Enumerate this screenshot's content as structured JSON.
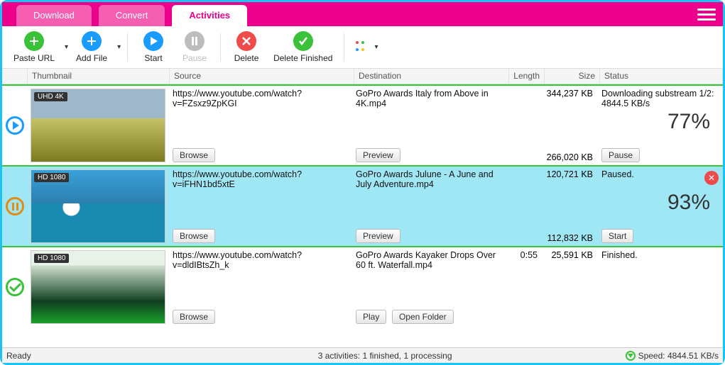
{
  "tabs": {
    "download": "Download",
    "convert": "Convert",
    "activities": "Activities"
  },
  "toolbar": {
    "pasteUrl": "Paste URL",
    "addFile": "Add File",
    "start": "Start",
    "pause": "Pause",
    "delete": "Delete",
    "deleteFinished": "Delete Finished"
  },
  "columns": {
    "thumbnail": "Thumbnail",
    "source": "Source",
    "destination": "Destination",
    "length": "Length",
    "size": "Size",
    "status": "Status"
  },
  "buttons": {
    "browse": "Browse",
    "preview": "Preview",
    "pause": "Pause",
    "start": "Start",
    "play": "Play",
    "openFolder": "Open Folder"
  },
  "rows": [
    {
      "badge": "UHD 4K",
      "source": "https://www.youtube.com/watch?v=FZsxz9ZpKGI",
      "destination": "GoPro Awards  Italy from Above in 4K.mp4",
      "length": "",
      "size1": "344,237 KB",
      "size2": "266,020 KB",
      "statusText": "Downloading substream 1/2: 4844.5 KB/s",
      "percent": "77%"
    },
    {
      "badge": "HD 1080",
      "source": "https://www.youtube.com/watch?v=iFHN1bd5xtE",
      "destination": "GoPro Awards  Julune - A June and July Adventure.mp4",
      "length": "",
      "size1": "120,721 KB",
      "size2": "112,832 KB",
      "statusText": "Paused.",
      "percent": "93%"
    },
    {
      "badge": "HD 1080",
      "source": "https://www.youtube.com/watch?v=dldIBtsZh_k",
      "destination": "GoPro Awards  Kayaker Drops Over 60 ft. Waterfall.mp4",
      "length": "0:55",
      "size1": "25,591 KB",
      "size2": "",
      "statusText": "Finished.",
      "percent": ""
    }
  ],
  "statusbar": {
    "left": "Ready",
    "mid": "3 activities: 1 finished, 1 processing",
    "right": "Speed: 4844.51 KB/s"
  }
}
